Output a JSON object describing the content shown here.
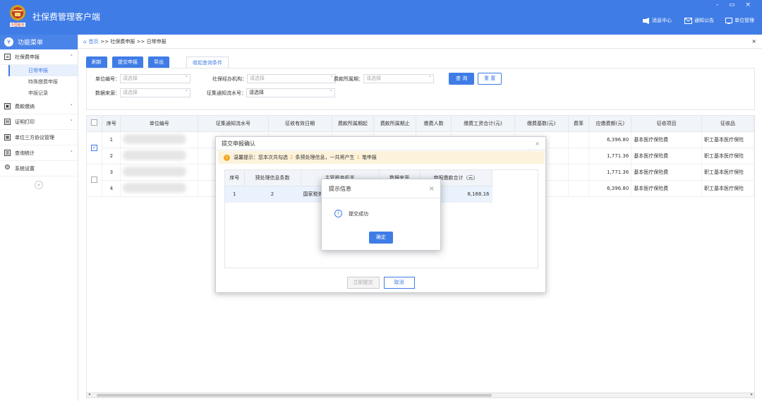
{
  "app": {
    "title": "社保费管理客户端",
    "logo_text": "中国税务",
    "controls": "-  ▭  ×"
  },
  "topnav": [
    {
      "icon": "message-center-icon",
      "label": "消息中心"
    },
    {
      "icon": "notice-icon",
      "label": "通知公告"
    },
    {
      "icon": "unit-management-icon",
      "label": "单位管理"
    }
  ],
  "sidebar": {
    "header": "功能菜单",
    "groups": [
      {
        "label": "社保费申报",
        "expanded": true,
        "items": [
          "日常申报",
          "特殊缴费申报",
          "申报记录"
        ]
      },
      {
        "label": "费款缴纳",
        "expanded": false
      },
      {
        "label": "证明打印",
        "expanded": false
      },
      {
        "label": "单位三方协议管理",
        "expanded": false
      },
      {
        "label": "查询统计",
        "expanded": false
      },
      {
        "label": "系统设置",
        "expanded": false
      }
    ],
    "collapse": "«"
  },
  "breadcrumb": {
    "home": "首页",
    "path": ">> 社保费申报 >> 日常申报",
    "close": "×"
  },
  "toolbar": {
    "refresh": "刷新",
    "submit": "提交申报",
    "export": "导出",
    "collapse_tab": "收起查询条件"
  },
  "filters": {
    "unit_no": "单位编号：",
    "agency": "社保经办机构：",
    "period": "费款所属期：",
    "source": "数据来源：",
    "notice_no": "征集通知流水号：",
    "placeholder": "请选择",
    "notice_placeholder": "请选择",
    "query": "查 询",
    "reset": "重 置"
  },
  "grid": {
    "headers": [
      "序号",
      "单位编号",
      "征集通知流水号",
      "征收有效日期",
      "费款所属期起",
      "费款所属期止",
      "缴费人数",
      "缴费工资合计(元)",
      "缴费基数(元)",
      "费率",
      "应缴费额(元)",
      "征收项目",
      "征收品"
    ],
    "rows": [
      {
        "no": "1",
        "checked": true,
        "prefix": "",
        "amount": "6,396.80",
        "item": "基本医疗保险费",
        "kind": "职工基本医疗保险"
      },
      {
        "no": "2",
        "checked": true,
        "prefix": "",
        "amount": "1,771.36",
        "item": "基本医疗保险费",
        "kind": "职工基本医疗保险"
      },
      {
        "no": "3",
        "checked": false,
        "prefix": "",
        "amount": "1,771.36",
        "item": "基本医疗保险费",
        "kind": "职工基本医疗保险"
      },
      {
        "no": "4",
        "checked": false,
        "prefix": "",
        "amount": "6,396.80",
        "item": "基本医疗保险费",
        "kind": "职工基本医疗保险"
      }
    ]
  },
  "dialog": {
    "title": "提交申报确认",
    "close": "×",
    "warn_a": "温馨提示：您本次共勾选",
    "warn_n1": "2",
    "warn_b": "条预处理信息，一共将产生",
    "warn_n2": "1",
    "warn_c": "笔申报",
    "headers": [
      "序号",
      "预处理信息条数",
      "主管税务机关",
      "数据来源",
      "申报缴款合计（元）"
    ],
    "row": {
      "no": "1",
      "count": "2",
      "org": "国家税务",
      "source": "",
      "total": "8,168.16"
    },
    "submit": "立即提交",
    "cancel": "取消"
  },
  "tip": {
    "title": "提示信息",
    "close": "×",
    "message": "提交成功",
    "ok": "确定"
  }
}
